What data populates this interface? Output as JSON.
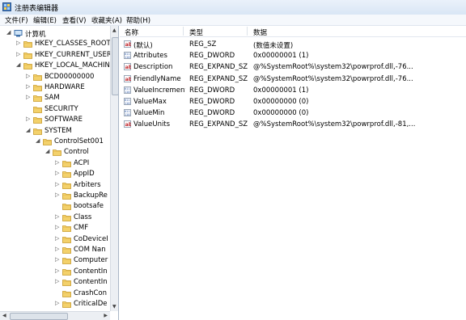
{
  "window": {
    "title": "注册表编辑器"
  },
  "menu": [
    "文件(F)",
    "编辑(E)",
    "查看(V)",
    "收藏夹(A)",
    "帮助(H)"
  ],
  "tree": [
    {
      "label": "计算机",
      "arrow": "◢",
      "icon": "computer-icon"
    },
    {
      "label": "HKEY_CLASSES_ROOT",
      "arrow": "▷",
      "icon": "folder-icon"
    },
    {
      "label": "HKEY_CURRENT_USER",
      "arrow": "▷",
      "icon": "folder-icon"
    },
    {
      "label": "HKEY_LOCAL_MACHINE",
      "arrow": "◢",
      "icon": "folder-icon"
    },
    {
      "label": "BCD00000000",
      "arrow": "▷",
      "icon": "folder-icon"
    },
    {
      "label": "HARDWARE",
      "arrow": "▷",
      "icon": "folder-icon"
    },
    {
      "label": "SAM",
      "arrow": "▷",
      "icon": "folder-icon"
    },
    {
      "label": "SECURITY",
      "arrow": "",
      "icon": "folder-icon"
    },
    {
      "label": "SOFTWARE",
      "arrow": "▷",
      "icon": "folder-icon"
    },
    {
      "label": "SYSTEM",
      "arrow": "◢",
      "icon": "folder-icon"
    },
    {
      "label": "ControlSet001",
      "arrow": "◢",
      "icon": "folder-icon"
    },
    {
      "label": "Control",
      "arrow": "◢",
      "icon": "folder-icon"
    },
    {
      "label": "ACPI",
      "arrow": "▷",
      "icon": "folder-icon"
    },
    {
      "label": "AppID",
      "arrow": "▷",
      "icon": "folder-icon"
    },
    {
      "label": "Arbiters",
      "arrow": "▷",
      "icon": "folder-icon"
    },
    {
      "label": "BackupRe",
      "arrow": "▷",
      "icon": "folder-icon"
    },
    {
      "label": "bootsafe",
      "arrow": "",
      "icon": "folder-icon"
    },
    {
      "label": "Class",
      "arrow": "▷",
      "icon": "folder-icon"
    },
    {
      "label": "CMF",
      "arrow": "▷",
      "icon": "folder-icon"
    },
    {
      "label": "CoDeviceI",
      "arrow": "▷",
      "icon": "folder-icon"
    },
    {
      "label": "COM Nan",
      "arrow": "▷",
      "icon": "folder-icon"
    },
    {
      "label": "Computer",
      "arrow": "▷",
      "icon": "folder-icon"
    },
    {
      "label": "ContentIn",
      "arrow": "▷",
      "icon": "folder-icon"
    },
    {
      "label": "ContentIn",
      "arrow": "▷",
      "icon": "folder-icon"
    },
    {
      "label": "CrashCon",
      "arrow": "",
      "icon": "folder-icon"
    },
    {
      "label": "CriticalDe",
      "arrow": "▷",
      "icon": "folder-icon"
    }
  ],
  "columns": {
    "name": "名称",
    "type": "类型",
    "data": "数据"
  },
  "values": [
    {
      "name": "(默认)",
      "type": "REG_SZ",
      "data": "(数值未设置)",
      "icon": "string-value-icon"
    },
    {
      "name": "Attributes",
      "type": "REG_DWORD",
      "data": "0x00000001 (1)",
      "icon": "binary-value-icon"
    },
    {
      "name": "Description",
      "type": "REG_EXPAND_SZ",
      "data": "@%SystemRoot%\\system32\\powrprof.dll,-76...",
      "icon": "string-value-icon"
    },
    {
      "name": "FriendlyName",
      "type": "REG_EXPAND_SZ",
      "data": "@%SystemRoot%\\system32\\powrprof.dll,-76...",
      "icon": "string-value-icon"
    },
    {
      "name": "ValueIncrement",
      "type": "REG_DWORD",
      "data": "0x00000001 (1)",
      "icon": "binary-value-icon"
    },
    {
      "name": "ValueMax",
      "type": "REG_DWORD",
      "data": "0x00000000 (0)",
      "icon": "binary-value-icon"
    },
    {
      "name": "ValueMin",
      "type": "REG_DWORD",
      "data": "0x00000000 (0)",
      "icon": "binary-value-icon"
    },
    {
      "name": "ValueUnits",
      "type": "REG_EXPAND_SZ",
      "data": "@%SystemRoot%\\system32\\powrprof.dll,-81,...",
      "icon": "string-value-icon"
    }
  ],
  "scroll": {
    "up": "▲",
    "down": "▼",
    "left": "◀",
    "right": "▶"
  }
}
